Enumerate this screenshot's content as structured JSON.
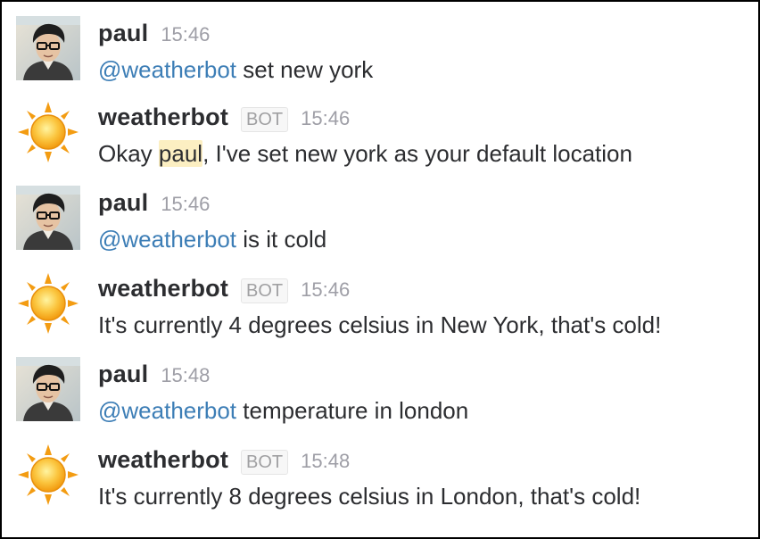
{
  "messages": [
    {
      "sender": "paul",
      "time": "15:46",
      "mention": "@weatherbot",
      "text": " set new york"
    },
    {
      "sender": "weatherbot",
      "badge": "BOT",
      "time": "15:46",
      "text_before": "Okay ",
      "highlight": "paul",
      "text_after": ", I've set new york as your default location"
    },
    {
      "sender": "paul",
      "time": "15:46",
      "mention": "@weatherbot",
      "text": " is it cold"
    },
    {
      "sender": "weatherbot",
      "badge": "BOT",
      "time": "15:46",
      "text": "It's currently 4 degrees celsius in New York, that's cold!"
    },
    {
      "sender": "paul",
      "time": "15:48",
      "mention": "@weatherbot",
      "text": " temperature in london"
    },
    {
      "sender": "weatherbot",
      "badge": "BOT",
      "time": "15:48",
      "text": "It's currently 8 degrees celsius in London, that's cold!"
    }
  ]
}
